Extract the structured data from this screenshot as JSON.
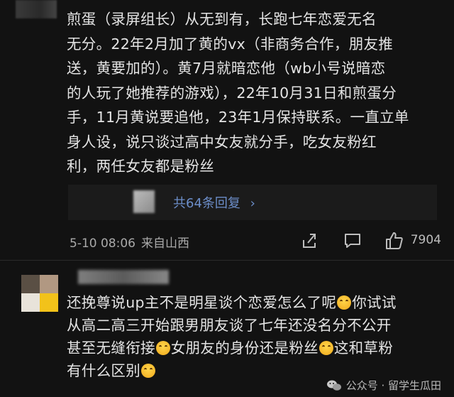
{
  "comment1": {
    "lines": [
      "煎蛋（录屏组长）从无到有，长跑七年恋爱无名",
      "无分。22年2月加了黄的vx（非商务合作，朋友推",
      "送，黄要加的）。黄7月就暗恋他（wb小号说暗恋",
      "的人玩了她推荐的游戏），22年10月31日和煎蛋分",
      "手，11月黄说要追他，23年1月保持联系。一直立单",
      "身人设，说只谈过高中女友就分手，吃女友粉红",
      "利，两任女友都是粉丝"
    ],
    "reply_link": "共64条回复",
    "reply_chevron": "›",
    "timestamp": "5-10 08:06",
    "location": "来自山西",
    "like_count": "7904"
  },
  "comment2": {
    "segments": [
      {
        "text": "还挽尊说up主不是明星谈个恋爱怎么了呢",
        "emoji": true
      },
      {
        "text": "你试试",
        "emoji": false,
        "br": true
      },
      {
        "text": "从高二高三开始跟男朋友谈了七年还没名分不公开",
        "emoji": false,
        "br": true
      },
      {
        "text": "甚至无缝衔接",
        "emoji": true
      },
      {
        "text": "女朋友的身份还是粉丝",
        "emoji": true
      },
      {
        "text": "这和草粉",
        "emoji": false,
        "br": true
      },
      {
        "text": "有什么区别",
        "emoji": true
      }
    ]
  },
  "icons": {
    "share": "share-icon",
    "comment": "comment-icon",
    "like": "thumbs-up-icon",
    "emoji": "laughing-emoji-icon",
    "watermark_logo": "wechat-official-account-icon"
  },
  "watermark": {
    "text": "公众号 · 留学生瓜田"
  },
  "colors": {
    "background": "#121212",
    "text": "#e4e4e4",
    "link": "#6c8ec9",
    "meta": "#a9a9a9"
  }
}
